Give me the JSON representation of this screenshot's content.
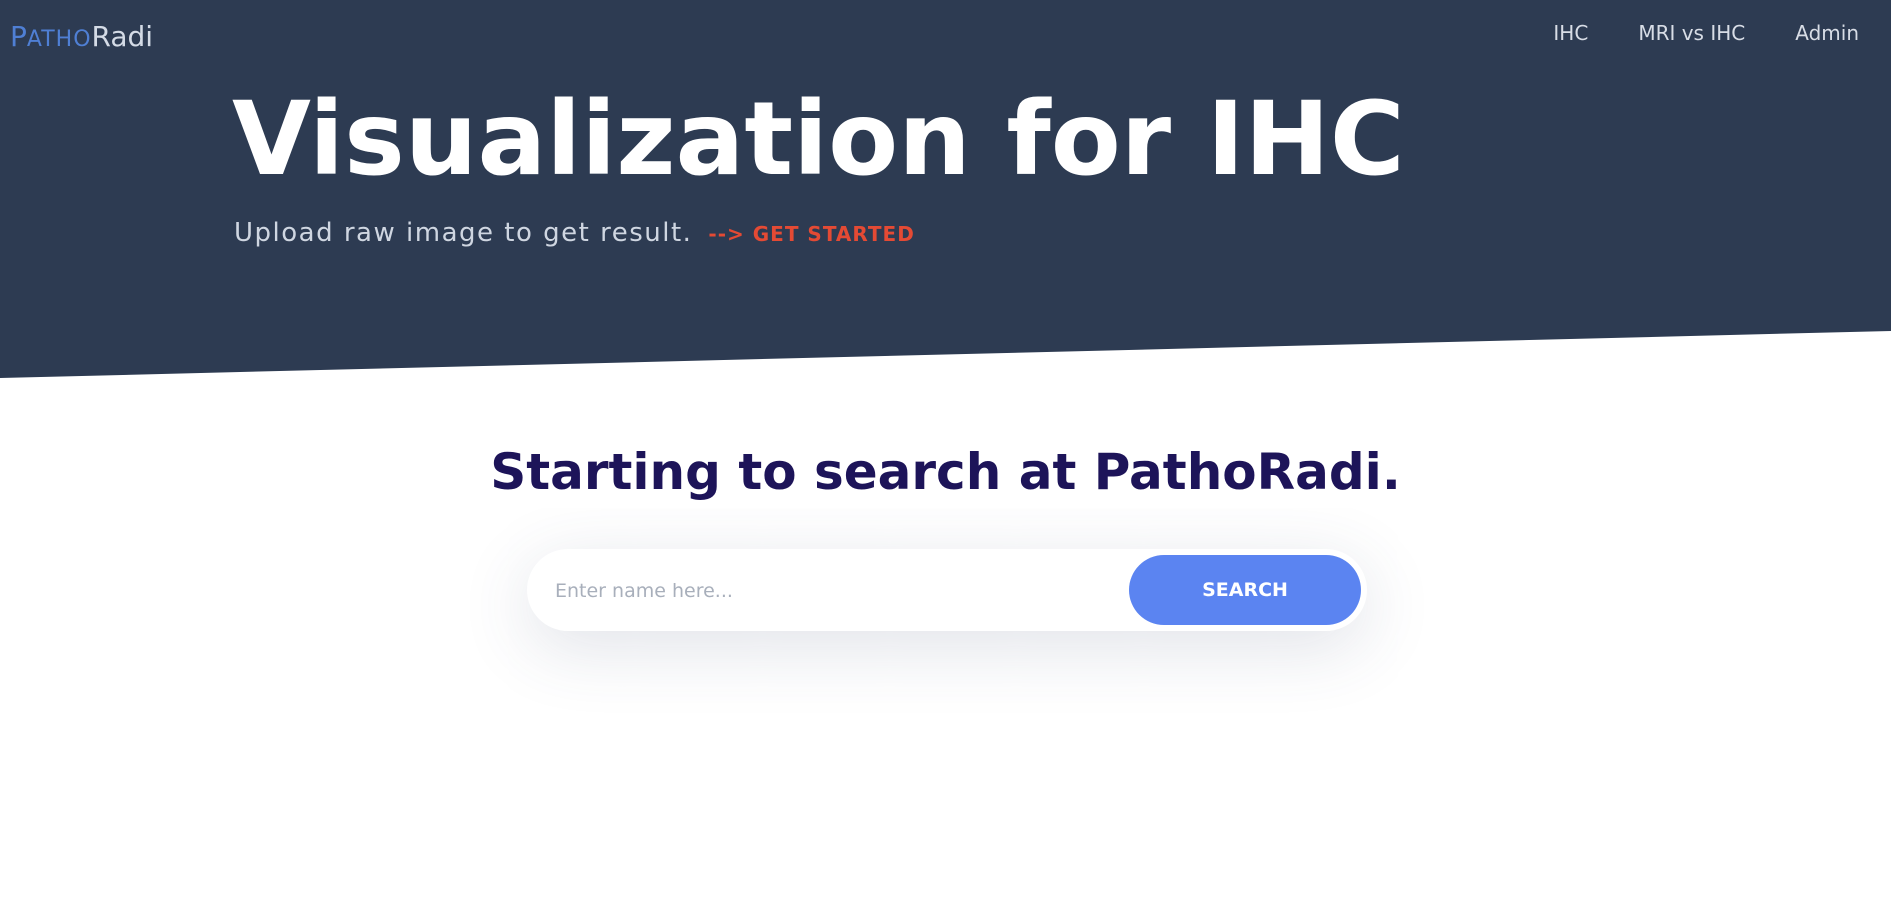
{
  "brand": {
    "first": "P",
    "small": "ATHO",
    "rest": "Radi"
  },
  "nav": {
    "items": [
      {
        "label": "IHC"
      },
      {
        "label": "MRI vs IHC"
      },
      {
        "label": "Admin"
      }
    ]
  },
  "hero": {
    "title": "Visualization for IHC",
    "subtitle": "Upload raw image to get result.",
    "cta_label": "--> GET STARTED"
  },
  "search": {
    "heading": "Starting to search at PathoRadi.",
    "placeholder": "Enter name here...",
    "value": "",
    "button_label": "SEARCH"
  },
  "colors": {
    "hero_background": "#2d3b52",
    "brand_accent": "#4f7fd4",
    "cta": "#e44a34",
    "heading": "#1d1459",
    "search_button": "#5b84f1"
  }
}
